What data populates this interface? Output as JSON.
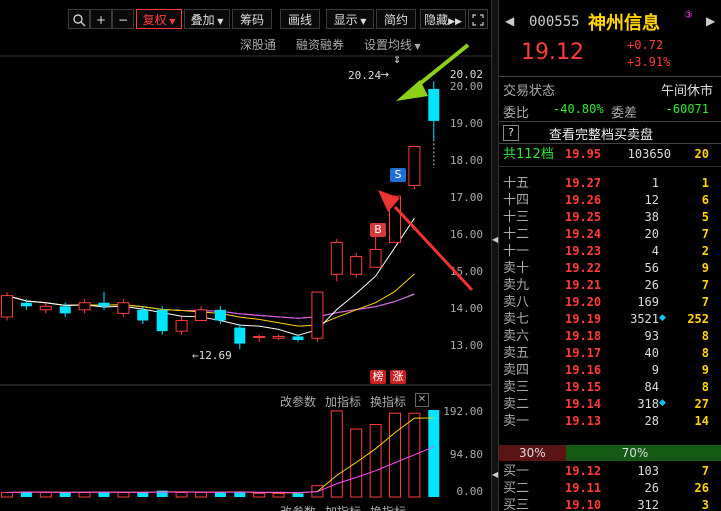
{
  "toolbar": {
    "buttons": [
      "复权",
      "叠加",
      "筹码",
      "画线",
      "显示",
      "简约",
      "隐藏"
    ],
    "sub_links": [
      "深股通",
      "融资融券",
      "设置均线"
    ]
  },
  "chart": {
    "price_axis": [
      "20.02",
      "20.00",
      "19.00",
      "18.00",
      "17.00",
      "16.00",
      "15.00",
      "14.00",
      "13.00"
    ],
    "high_label": "20.24",
    "low_label": "12.69",
    "tags": {
      "buy": "B",
      "sell": "S",
      "rank": "榜",
      "rise": "涨"
    },
    "vol_axis": [
      "192.00",
      "94.80",
      "0.00"
    ],
    "vol_links": [
      "改参数",
      "加指标",
      "换指标"
    ],
    "colors": {
      "up": "#ff3b3b",
      "down": "#00e5ff",
      "ma5": "#ffffff",
      "ma10": "#ffd400",
      "ma20": "#ff44ff",
      "ma30": "#22dd22",
      "ma60": "#00c8c8",
      "arrow_green": "#8cd219",
      "arrow_red": "#ee3333"
    }
  },
  "chart_data": {
    "type": "candlestick",
    "ylim": [
      12.5,
      20.3
    ],
    "candles": [
      {
        "o": 13.6,
        "c": 14.2,
        "h": 14.3,
        "l": 13.5
      },
      {
        "o": 14.0,
        "c": 13.9,
        "h": 14.1,
        "l": 13.8
      },
      {
        "o": 13.8,
        "c": 13.9,
        "h": 14.0,
        "l": 13.7
      },
      {
        "o": 13.9,
        "c": 13.7,
        "h": 14.0,
        "l": 13.6
      },
      {
        "o": 13.8,
        "c": 14.0,
        "h": 14.1,
        "l": 13.7
      },
      {
        "o": 14.0,
        "c": 13.9,
        "h": 14.3,
        "l": 13.8
      },
      {
        "o": 13.7,
        "c": 14.0,
        "h": 14.1,
        "l": 13.6
      },
      {
        "o": 13.8,
        "c": 13.5,
        "h": 13.9,
        "l": 13.4
      },
      {
        "o": 13.8,
        "c": 13.2,
        "h": 13.9,
        "l": 13.1
      },
      {
        "o": 13.2,
        "c": 13.5,
        "h": 13.6,
        "l": 13.1
      },
      {
        "o": 13.5,
        "c": 13.8,
        "h": 13.9,
        "l": 13.5
      },
      {
        "o": 13.8,
        "c": 13.5,
        "h": 13.9,
        "l": 13.4
      },
      {
        "o": 13.3,
        "c": 12.85,
        "h": 13.4,
        "l": 12.69
      },
      {
        "o": 13.05,
        "c": 13.05,
        "h": 13.1,
        "l": 12.9
      },
      {
        "o": 13.0,
        "c": 13.05,
        "h": 13.1,
        "l": 12.95
      },
      {
        "o": 13.05,
        "c": 12.95,
        "h": 13.1,
        "l": 12.9
      },
      {
        "o": 13.0,
        "c": 14.3,
        "h": 14.3,
        "l": 12.9
      },
      {
        "o": 14.8,
        "c": 15.7,
        "h": 15.8,
        "l": 14.6
      },
      {
        "o": 14.8,
        "c": 15.3,
        "h": 15.4,
        "l": 14.7
      },
      {
        "o": 15.0,
        "c": 15.5,
        "h": 15.9,
        "l": 15.0
      },
      {
        "o": 15.7,
        "c": 17.0,
        "h": 17.0,
        "l": 15.7
      },
      {
        "o": 17.3,
        "c": 18.4,
        "h": 18.4,
        "l": 17.2
      },
      {
        "o": 20.02,
        "c": 19.12,
        "h": 20.24,
        "l": 18.6
      }
    ],
    "volumes": [
      10,
      12,
      10,
      10,
      10,
      12,
      10,
      10,
      14,
      10,
      10,
      10,
      12,
      8,
      8,
      8,
      25,
      190,
      150,
      160,
      185,
      185,
      192
    ],
    "vol_ylim": [
      0,
      192
    ]
  },
  "quote": {
    "code": "000555",
    "name": "神州信息",
    "badge": "③",
    "price": "19.12",
    "change": "+0.72",
    "pct": "+3.91%",
    "status_label": "交易状态",
    "status_value": "午间休市",
    "webi_label": "委比",
    "webi_value": "-40.80%",
    "weicha_label": "委差",
    "weicha_value": "-60071",
    "full_book": "查看完整档买卖盘",
    "help": "?",
    "levels_label": "共112档",
    "levels_price": "19.95",
    "levels_vol": "103650",
    "levels_cnt": "20"
  },
  "asks": [
    {
      "label": "十五",
      "price": "19.27",
      "vol": "1",
      "cnt": "1"
    },
    {
      "label": "十四",
      "price": "19.26",
      "vol": "12",
      "cnt": "6"
    },
    {
      "label": "十三",
      "price": "19.25",
      "vol": "38",
      "cnt": "5"
    },
    {
      "label": "十二",
      "price": "19.24",
      "vol": "20",
      "cnt": "7"
    },
    {
      "label": "十一",
      "price": "19.23",
      "vol": "4",
      "cnt": "2"
    },
    {
      "label": "卖十",
      "price": "19.22",
      "vol": "56",
      "cnt": "9"
    },
    {
      "label": "卖九",
      "price": "19.21",
      "vol": "26",
      "cnt": "7"
    },
    {
      "label": "卖八",
      "price": "19.20",
      "vol": "169",
      "cnt": "7"
    },
    {
      "label": "卖七",
      "price": "19.19",
      "vol": "3521",
      "cnt": "252"
    },
    {
      "label": "卖六",
      "price": "19.18",
      "vol": "93",
      "cnt": "8"
    },
    {
      "label": "卖五",
      "price": "19.17",
      "vol": "40",
      "cnt": "8"
    },
    {
      "label": "卖四",
      "price": "19.16",
      "vol": "9",
      "cnt": "9"
    },
    {
      "label": "卖三",
      "price": "19.15",
      "vol": "84",
      "cnt": "8"
    },
    {
      "label": "卖二",
      "price": "19.14",
      "vol": "318",
      "cnt": "27"
    },
    {
      "label": "卖一",
      "price": "19.13",
      "vol": "28",
      "cnt": "14"
    }
  ],
  "ratio": {
    "sell": "30%",
    "buy": "70%",
    "sell_frac": 0.3
  },
  "bids": [
    {
      "label": "买一",
      "price": "19.12",
      "vol": "103",
      "cnt": "7"
    },
    {
      "label": "买二",
      "price": "19.11",
      "vol": "26",
      "cnt": "26"
    },
    {
      "label": "买三",
      "price": "19.10",
      "vol": "312",
      "cnt": "3"
    }
  ]
}
